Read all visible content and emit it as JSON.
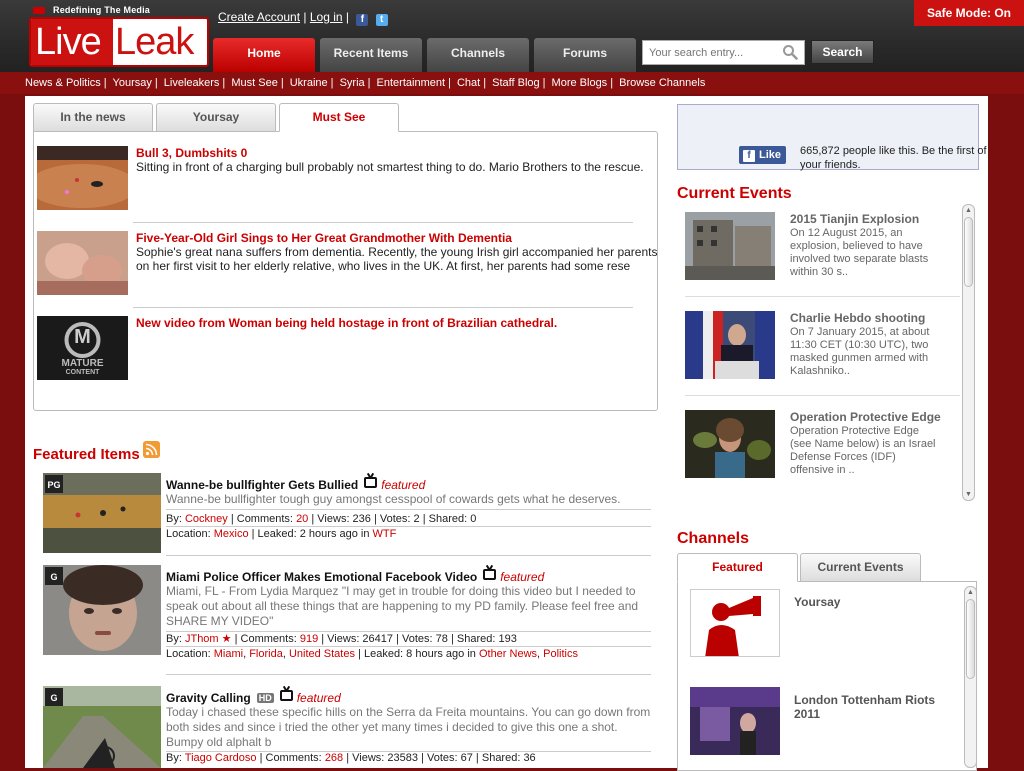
{
  "header": {
    "tagline": "Redefining The Media",
    "logo_live": "Live",
    "logo_leak": "Leak",
    "create_account": "Create Account",
    "login": "Log in",
    "safe_mode": "Safe Mode: On",
    "nav": [
      "Home",
      "Recent Items",
      "Channels",
      "Forums"
    ],
    "search_placeholder": "Your search entry...",
    "search_button": "Search"
  },
  "subnav": [
    "News & Politics",
    "Yoursay",
    "Liveleakers",
    "Must See",
    "Ukraine",
    "Syria",
    "Entertainment",
    "Chat",
    "Staff Blog",
    "More Blogs",
    "Browse Channels"
  ],
  "main_tabs": [
    "In the news",
    "Yoursay",
    "Must See"
  ],
  "news_items": [
    {
      "title": "Bull 3, Dumbshits 0",
      "desc": "Sitting in front of a charging bull probably not smartest thing to do. Mario Brothers to the rescue."
    },
    {
      "title": "Five-Year-Old Girl Sings to Her Great Grandmother With Dementia",
      "desc": "Sophie's great nana suffers from dementia. Recently, the young Irish girl accompanied her parents on her first visit to her elderly relative, who lives in the UK. At first, her parents had some rese"
    },
    {
      "title": "New video from Woman being held hostage in front of Brazilian cathedral.",
      "desc": "",
      "thumb_text": [
        "MATURE",
        "CONTENT"
      ],
      "thumb_letter": "M"
    }
  ],
  "featured": {
    "heading": "Featured Items",
    "featured_label": "featured",
    "items": [
      {
        "rating": "PG",
        "title": "Wanne-be bullfighter Gets Bullied",
        "desc": "Wanne-be bullfighter tough guy amongst cesspool of cowards gets what he deserves.",
        "by_label": "By:",
        "author": "Cockney",
        "comments_label": "Comments:",
        "comments": "20",
        "views": "Views: 236",
        "votes": "Votes: 2",
        "shared": "Shared: 0",
        "location_label": "Location:",
        "locations": [
          "Mexico"
        ],
        "leaked": "Leaked: 2 hours ago in",
        "categories": [
          "WTF"
        ]
      },
      {
        "rating": "G",
        "title": "Miami Police Officer Makes Emotional Facebook Video",
        "desc": "Miami, FL - From Lydia Marquez \"I may get in trouble for doing this video but I needed to speak out about all these things that are happening to my PD family. Please feel free and SHARE MY VIDEO\"",
        "by_label": "By:",
        "author": "JThom",
        "comments_label": "Comments:",
        "comments": "919",
        "views": "Views: 26417",
        "votes": "Votes: 78",
        "shared": "Shared: 193",
        "location_label": "Location:",
        "locations": [
          "Miami",
          "Florida",
          "United States"
        ],
        "leaked": "Leaked: 8 hours ago in",
        "categories": [
          "Other News",
          "Politics"
        ]
      },
      {
        "rating": "G",
        "hd": "HD",
        "title": "Gravity Calling",
        "desc": "Today i chased these specific hills on the Serra da Freita mountains. You can go down from both sides and since i tried the other yet many times i decided to give this one a shot. Bumpy old alphalt b",
        "by_label": "By:",
        "author": "Tiago Cardoso",
        "comments_label": "Comments:",
        "comments": "268",
        "views": "Views: 23583",
        "votes": "Votes: 67",
        "shared": "Shared: 36"
      }
    ]
  },
  "facebook": {
    "like_label": "Like",
    "text": "665,872 people like this. Be the first of your friends."
  },
  "current_events": {
    "heading": "Current Events",
    "items": [
      {
        "title": "2015 Tianjin Explosion",
        "desc": "On 12 August 2015, an explosion, believed to have involved two separate blasts within 30 s.."
      },
      {
        "title": "Charlie Hebdo shooting",
        "desc": "On 7 January 2015, at about 11:30 CET (10:30 UTC), two masked gunmen armed with Kalashniko.."
      },
      {
        "title": "Operation Protective Edge",
        "desc": "Operation Protective Edge (see Name below) is an Israel Defense Forces (IDF) offensive in .."
      }
    ]
  },
  "channels": {
    "heading": "Channels",
    "tabs": [
      "Featured",
      "Current Events"
    ],
    "items": [
      {
        "name": "Yoursay"
      },
      {
        "name": "London Tottenham Riots 2011"
      }
    ]
  },
  "colors": {
    "brand_red": "#cc0000",
    "background": "#7a0d0d",
    "header": "#2a2a2a"
  }
}
